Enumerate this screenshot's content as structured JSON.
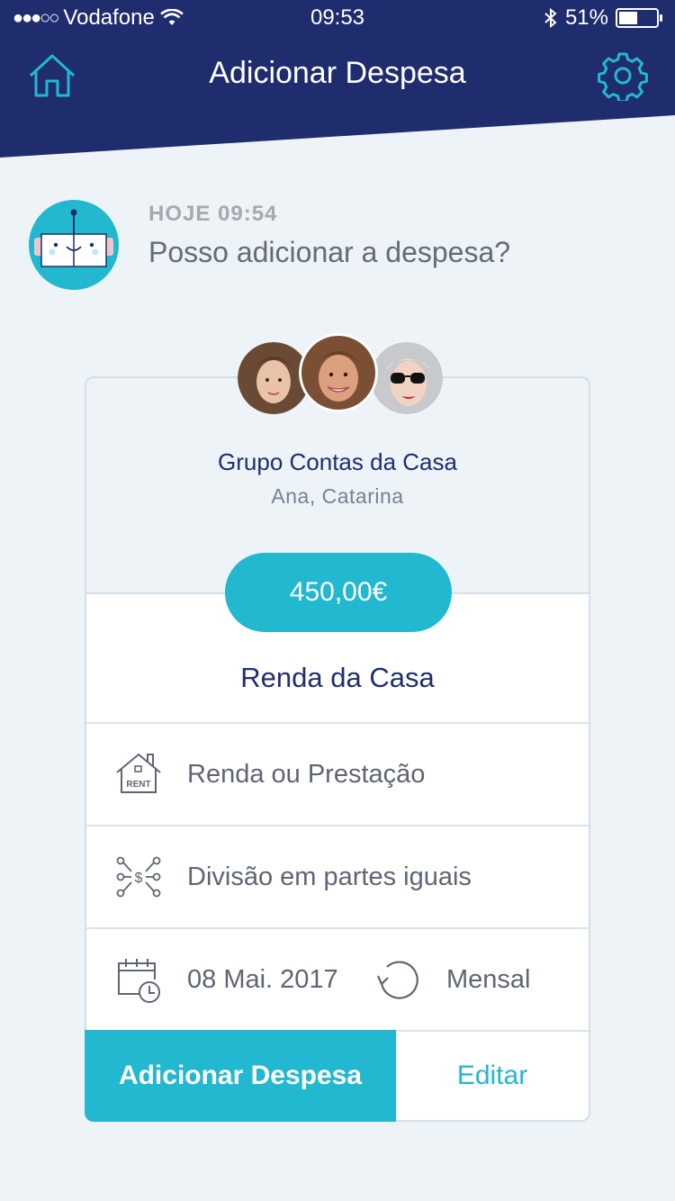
{
  "status_bar": {
    "carrier": "Vodafone",
    "time": "09:53",
    "battery": "51%",
    "battery_level": 0.51
  },
  "header": {
    "title": "Adicionar Despesa",
    "home_icon": "home-icon",
    "settings_icon": "gear-icon"
  },
  "colors": {
    "header": "#1f2d6e",
    "accent": "#22b8cf",
    "background": "#edf3f7"
  },
  "message": {
    "time": "HOJE 09:54",
    "text": "Posso adicionar a despesa?"
  },
  "card": {
    "group_name": "Grupo Contas da Casa",
    "members": "Ana, Catarina",
    "amount": "450,00€",
    "expense_title": "Renda da Casa",
    "category": "Renda ou Prestação",
    "category_icon_text": "RENT",
    "split": "Divisão em partes iguais",
    "date": "08 Mai. 2017",
    "recurrence": "Mensal"
  },
  "actions": {
    "add_label": "Adicionar Despesa",
    "edit_label": "Editar"
  }
}
